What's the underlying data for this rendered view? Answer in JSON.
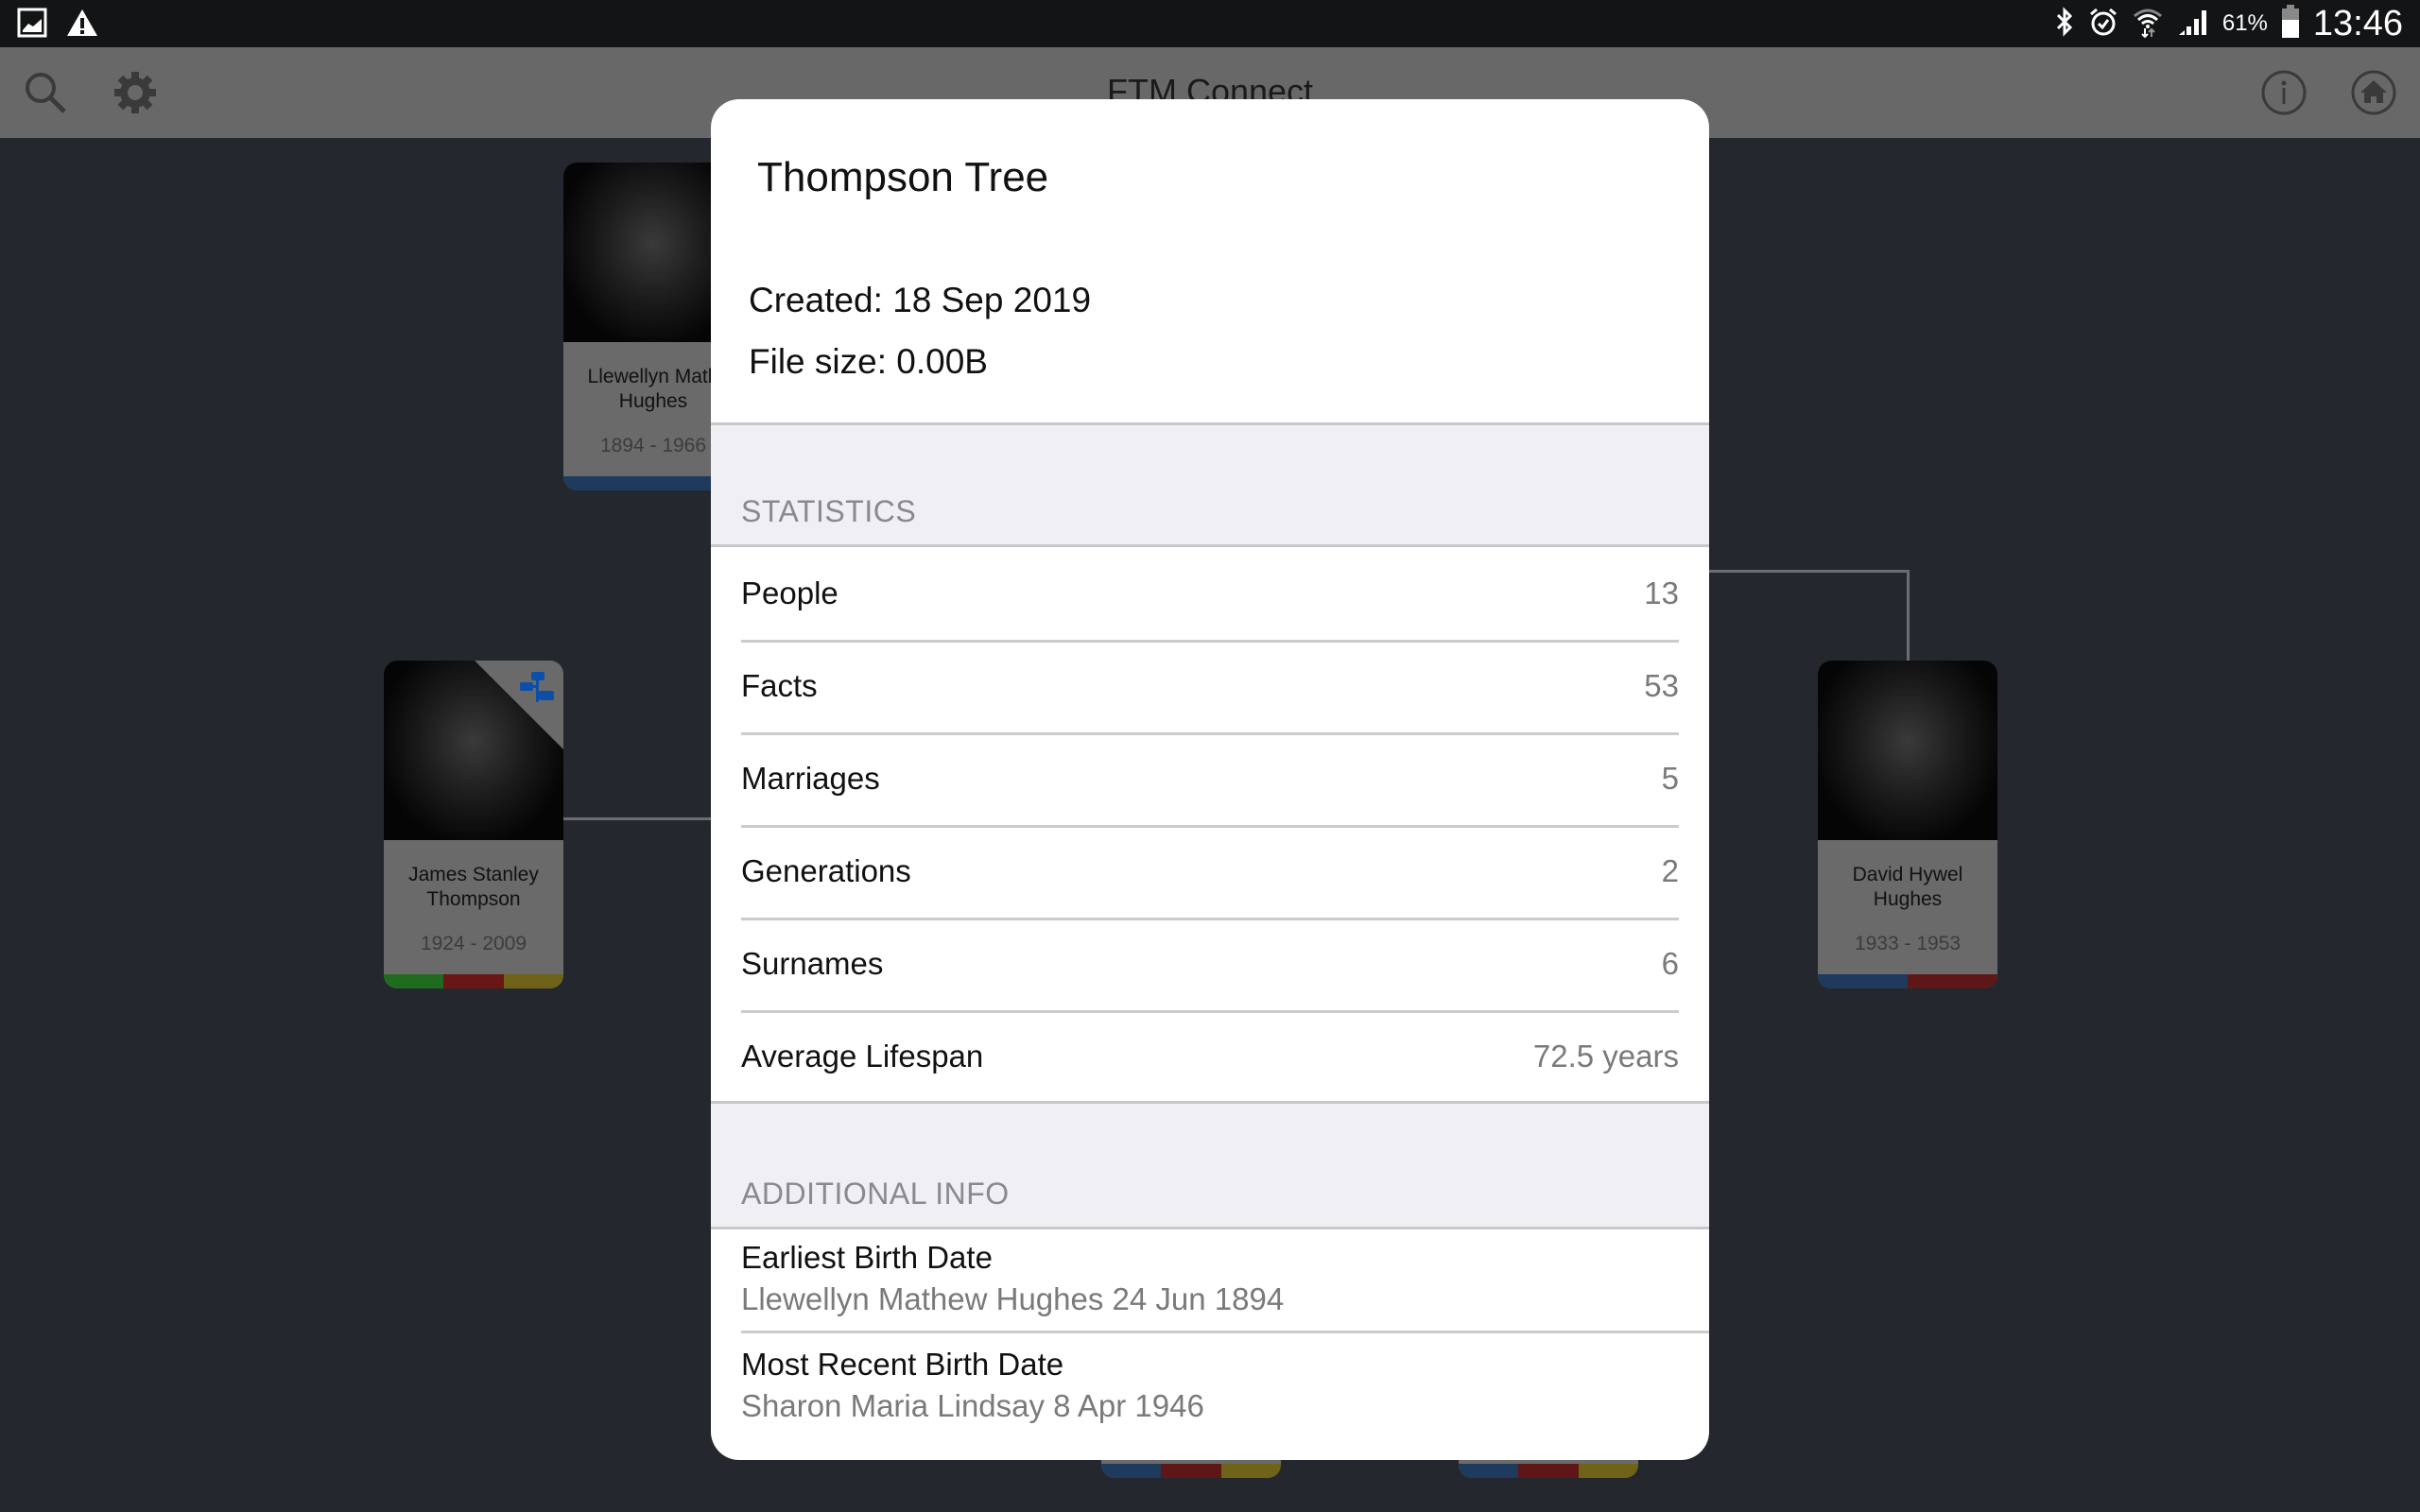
{
  "status_bar": {
    "left_icons": [
      "gallery-notification-icon",
      "warning-icon"
    ],
    "right_icons": [
      "bluetooth-icon",
      "alarm-icon",
      "wifi-icon",
      "signal-icon"
    ],
    "battery_percent": "61%",
    "battery_level": 0.61,
    "time": "13:46"
  },
  "toolbar": {
    "title": "FTM Connect",
    "left_icons": [
      "search-icon",
      "gear-icon"
    ],
    "right_icons": [
      "info-icon",
      "home-icon"
    ]
  },
  "tree": {
    "people": [
      {
        "name_line1": "Llewellyn Math",
        "name_line2": "Hughes",
        "dates": "1894 - 1966",
        "bars": [
          "#1e3a5c",
          "#1e3a5c"
        ]
      },
      {
        "name_line1": "James Stanley",
        "name_line2": "Thompson",
        "dates": "1924 - 2009",
        "bars": [
          "#1f6b1f",
          "#6b1616",
          "#6e6318"
        ],
        "badge": "tree-branch-icon"
      },
      {
        "name_line1": "David Hywel",
        "name_line2": "Hughes",
        "dates": "1933 - 1953",
        "bars": [
          "#1e3a5c",
          "#5e1616"
        ]
      },
      {
        "bars": [
          "#1e3a5c",
          "#5e1616",
          "#6e6318"
        ]
      },
      {
        "bars": [
          "#1e3a5c",
          "#5e1616",
          "#6e6318"
        ]
      }
    ]
  },
  "dialog": {
    "title": "Thompson Tree",
    "created": "Created: 18 Sep 2019",
    "file_size": "File size: 0.00B",
    "statistics_header": "STATISTICS",
    "statistics": [
      {
        "label": "People",
        "value": "13"
      },
      {
        "label": "Facts",
        "value": "53"
      },
      {
        "label": "Marriages",
        "value": "5"
      },
      {
        "label": "Generations",
        "value": "2"
      },
      {
        "label": "Surnames",
        "value": "6"
      },
      {
        "label": "Average Lifespan",
        "value": "72.5 years"
      }
    ],
    "additional_header": "ADDITIONAL INFO",
    "additional": [
      {
        "label": "Earliest Birth Date",
        "value": "Llewellyn Mathew Hughes 24 Jun 1894"
      },
      {
        "label": "Most Recent Birth Date",
        "value": "Sharon Maria Lindsay 8 Apr 1946"
      }
    ]
  }
}
